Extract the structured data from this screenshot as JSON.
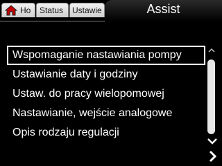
{
  "tabs": {
    "home_label": "Ho",
    "status_label": "Status",
    "settings_label": "Ustawie",
    "active_title": "Assist"
  },
  "menu": {
    "items": [
      {
        "label": "Wspomaganie nastawiania pompy",
        "selected": true
      },
      {
        "label": "Ustawianie daty i godziny",
        "selected": false
      },
      {
        "label": "Ustaw. do pracy wielopomowej",
        "selected": false
      },
      {
        "label": "Nastawianie, wejście analogowe",
        "selected": false
      },
      {
        "label": "Opis rodzaju regulacji",
        "selected": false
      }
    ]
  },
  "icons": {
    "home": "home-icon",
    "scroll_up": "chevron-up-icon",
    "scroll_down": "chevron-down-icon",
    "next": "chevron-right-icon"
  },
  "colors": {
    "background": "#000000",
    "text": "#ffffff",
    "tab_inactive": "#dcdcdc"
  }
}
